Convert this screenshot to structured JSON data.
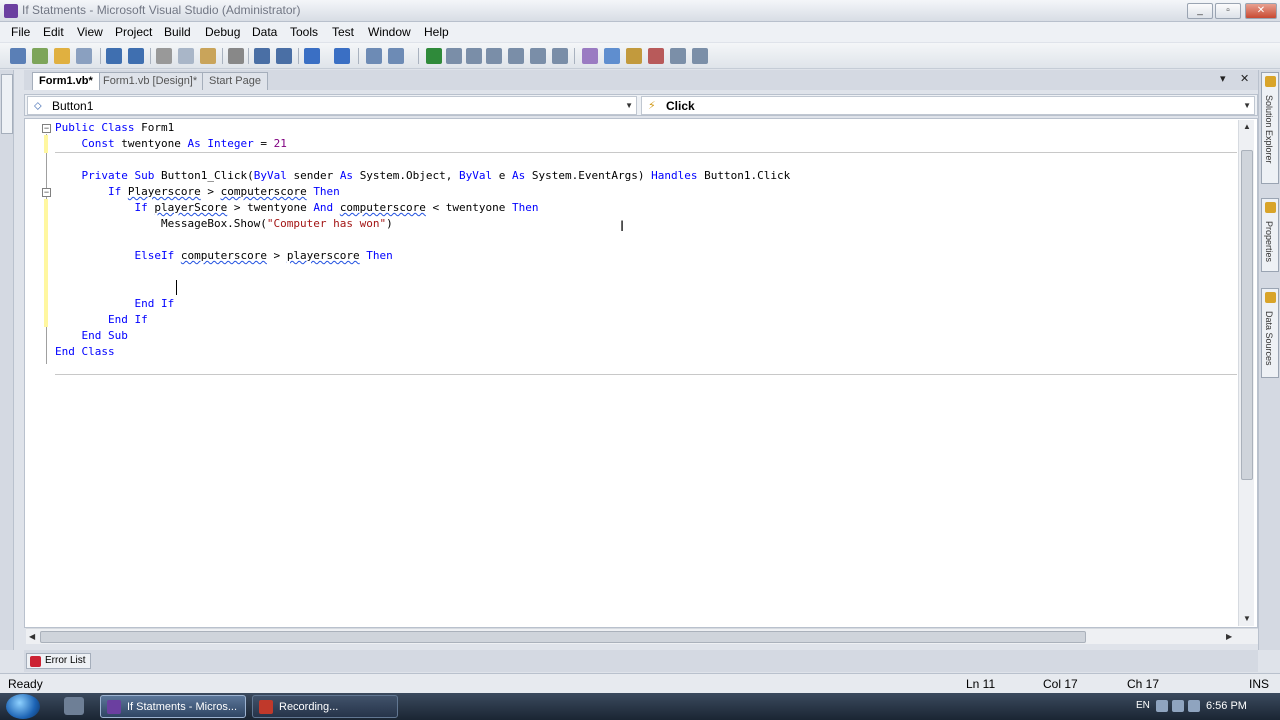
{
  "window": {
    "title": "If Statments - Microsoft Visual Studio (Administrator)",
    "minimize_glyph": "_",
    "maximize_glyph": "▫",
    "close_glyph": "✕"
  },
  "menu": [
    "File",
    "Edit",
    "View",
    "Project",
    "Build",
    "Debug",
    "Data",
    "Tools",
    "Test",
    "Window",
    "Help"
  ],
  "doc_tabs": [
    {
      "label": "Form1.vb*",
      "active": true
    },
    {
      "label": "Form1.vb [Design]*",
      "active": false
    },
    {
      "label": "Start Page",
      "active": false
    }
  ],
  "doc_tab_controls": {
    "dropdown_glyph": "▾",
    "close_glyph": "✕"
  },
  "combos": {
    "object": {
      "value": "Button1",
      "icon": "⬦"
    },
    "event": {
      "value": "Click",
      "icon": "⚡"
    }
  },
  "side_panels": [
    "Solution Explorer",
    "Properties",
    "Data Sources"
  ],
  "code_lines": [
    [
      {
        "t": "Public Class ",
        "c": "kw"
      },
      {
        "t": "Form1"
      }
    ],
    [
      {
        "t": "    "
      },
      {
        "t": "Const ",
        "c": "kw"
      },
      {
        "t": "twentyone "
      },
      {
        "t": "As Integer",
        "c": "kw"
      },
      {
        "t": " = "
      },
      {
        "t": "21",
        "c": "num"
      }
    ],
    [],
    [
      {
        "t": "    "
      },
      {
        "t": "Private Sub ",
        "c": "kw"
      },
      {
        "t": "Button1_Click("
      },
      {
        "t": "ByVal ",
        "c": "kw"
      },
      {
        "t": "sender "
      },
      {
        "t": "As ",
        "c": "kw"
      },
      {
        "t": "System.Object, "
      },
      {
        "t": "ByVal ",
        "c": "kw"
      },
      {
        "t": "e "
      },
      {
        "t": "As ",
        "c": "kw"
      },
      {
        "t": "System.EventArgs) "
      },
      {
        "t": "Handles ",
        "c": "kw"
      },
      {
        "t": "Button1.Click"
      }
    ],
    [
      {
        "t": "        "
      },
      {
        "t": "If ",
        "c": "kw"
      },
      {
        "t": "Playerscore",
        "c": "squig"
      },
      {
        "t": " > "
      },
      {
        "t": "computerscore",
        "c": "squig"
      },
      {
        "t": " "
      },
      {
        "t": "Then",
        "c": "kw"
      }
    ],
    [
      {
        "t": "            "
      },
      {
        "t": "If ",
        "c": "kw"
      },
      {
        "t": "playerScore",
        "c": "squig"
      },
      {
        "t": " > twentyone "
      },
      {
        "t": "And ",
        "c": "kw"
      },
      {
        "t": "computerscore",
        "c": "squig"
      },
      {
        "t": " < twentyone "
      },
      {
        "t": "Then",
        "c": "kw"
      }
    ],
    [
      {
        "t": "                MessageBox.Show("
      },
      {
        "t": "\"Computer has won\"",
        "c": "str"
      },
      {
        "t": ")"
      }
    ],
    [],
    [
      {
        "t": "            "
      },
      {
        "t": "ElseIf ",
        "c": "kw"
      },
      {
        "t": "computerscore",
        "c": "squig"
      },
      {
        "t": " > "
      },
      {
        "t": "playerscore",
        "c": "squig"
      },
      {
        "t": " "
      },
      {
        "t": "Then",
        "c": "kw"
      }
    ],
    [
      {
        "t": "                "
      }
    ],
    [],
    [
      {
        "t": "            "
      },
      {
        "t": "End If",
        "c": "kw"
      }
    ],
    [
      {
        "t": "        "
      },
      {
        "t": "End If",
        "c": "kw"
      }
    ],
    [
      {
        "t": "    "
      },
      {
        "t": "End Sub",
        "c": "kw"
      }
    ],
    [
      {
        "t": "End Class",
        "c": "kw"
      }
    ]
  ],
  "bottom_tab": {
    "label": "Error List"
  },
  "status": {
    "text": "Ready",
    "line": "Ln 11",
    "col": "Col 17",
    "ch": "Ch 17",
    "mode": "INS"
  },
  "taskbar": {
    "tasks": [
      {
        "label": "If Statments - Micros...",
        "active": true,
        "icon_color": "#6b3fa0"
      },
      {
        "label": "Recording...",
        "active": false,
        "icon_color": "#c0392b"
      }
    ],
    "tray_lang": "EN",
    "clock": "6:56 PM"
  },
  "colors": {
    "keyword": "#0000ff",
    "string": "#a31515",
    "number": "#800080",
    "squiggle": "#2050e0"
  }
}
